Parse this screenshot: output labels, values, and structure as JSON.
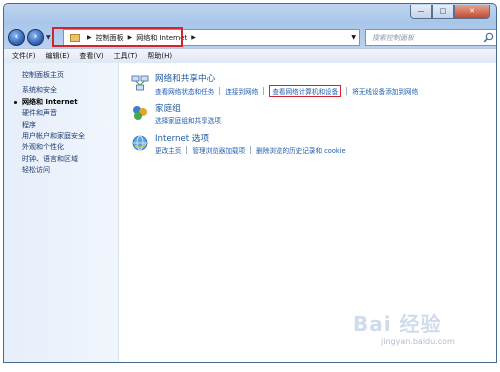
{
  "window": {
    "caption_buttons": {
      "minimize": "—",
      "maximize": "□",
      "close": "✕"
    }
  },
  "navbar": {
    "breadcrumb": [
      {
        "label": "控制面板"
      },
      {
        "label": "网络和 Internet"
      }
    ],
    "search_placeholder": "搜索控制面板",
    "refresh_symbol": "↻"
  },
  "menubar": {
    "items": [
      "文件(F)",
      "编辑(E)",
      "查看(V)",
      "工具(T)",
      "帮助(H)"
    ]
  },
  "sidebar": {
    "home": "控制面板主页",
    "items": [
      {
        "label": "系统和安全",
        "current": false
      },
      {
        "label": "网络和 Internet",
        "current": true
      },
      {
        "label": "硬件和声音",
        "current": false
      },
      {
        "label": "程序",
        "current": false
      },
      {
        "label": "用户帐户和家庭安全",
        "current": false
      },
      {
        "label": "外观和个性化",
        "current": false
      },
      {
        "label": "时钟、语言和区域",
        "current": false
      },
      {
        "label": "轻松访问",
        "current": false
      }
    ]
  },
  "categories": [
    {
      "title": "网络和共享中心",
      "icon": "network-sharing-icon",
      "links": [
        "查看网络状态和任务",
        "连接到网络",
        "查看网络计算机和设备",
        "将无线设备添加到网络"
      ],
      "highlighted_link_index": 2
    },
    {
      "title": "家庭组",
      "icon": "homegroup-icon",
      "links": [
        "选择家庭组和共享选项"
      ]
    },
    {
      "title": "Internet 选项",
      "icon": "internet-options-icon",
      "links": [
        "更改主页",
        "管理浏览器加载项",
        "删除浏览的历史记录和 cookie"
      ]
    }
  ],
  "watermark": {
    "logo_text": "Bai 经验",
    "sub_text": "jingyan.baidu.com"
  },
  "colors": {
    "link": "#1f5cb0",
    "category_title": "#1c5a9e",
    "highlight": "#d1242b",
    "sidebar_bg": "#e6eefa"
  }
}
